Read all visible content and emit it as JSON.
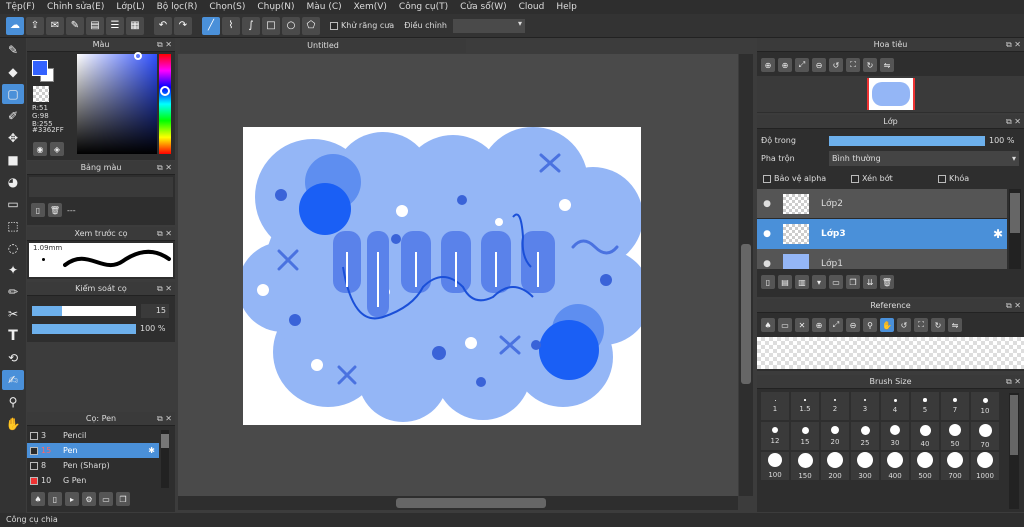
{
  "menu": [
    "Tệp(F)",
    "Chỉnh sửa(E)",
    "Lớp(L)",
    "Bộ lọc(R)",
    "Chọn(S)",
    "Chụp(N)",
    "Màu (C)",
    "Xem(V)",
    "Công cụ(T)",
    "Cửa sổ(W)",
    "Cloud",
    "Help"
  ],
  "toolbar": {
    "antialias": "Khử răng cưa",
    "adjust": "Điều chỉnh"
  },
  "color_panel": {
    "title": "Màu",
    "r": "R:51",
    "g": "G:98",
    "b": "B:255",
    "hex": "#3362FF",
    "fg": "#3362ff"
  },
  "palette_panel": {
    "title": "Bảng màu",
    "value": "---"
  },
  "preview_panel": {
    "title": "Xem trước cọ",
    "size": "1.09mm"
  },
  "control_panel": {
    "title": "Kiểm soát cọ",
    "size_value": "15",
    "opacity_value": "100 %"
  },
  "brush_panel": {
    "title": "Cọ: Pen",
    "items": [
      {
        "num": "3",
        "name": "Pencil"
      },
      {
        "num": "15",
        "name": "Pen"
      },
      {
        "num": "8",
        "name": "Pen (Sharp)"
      },
      {
        "num": "10",
        "name": "G Pen"
      }
    ]
  },
  "canvas": {
    "tab": "Untitled",
    "letters": "yeeer"
  },
  "nav_panel": {
    "title": "Hoa tiêu"
  },
  "layer_panel": {
    "title": "Lớp",
    "opacity_label": "Độ trong",
    "opacity_value": "100 %",
    "blend_label": "Pha trộn",
    "blend_value": "Bình thường",
    "protect_alpha": "Bảo vệ alpha",
    "clipping": "Xén bớt",
    "lock": "Khóa",
    "layers": [
      "Lớp2",
      "Lớp3",
      "Lớp1"
    ]
  },
  "reference_panel": {
    "title": "Reference"
  },
  "brushsize_panel": {
    "title": "Brush Size",
    "sizes": [
      "1",
      "1.5",
      "2",
      "3",
      "4",
      "5",
      "7",
      "10",
      "12",
      "15",
      "20",
      "25",
      "30",
      "40",
      "50",
      "70",
      "100",
      "150",
      "200",
      "300",
      "400",
      "500",
      "700",
      "1000"
    ]
  },
  "status": {
    "text": "Công cụ chia"
  }
}
